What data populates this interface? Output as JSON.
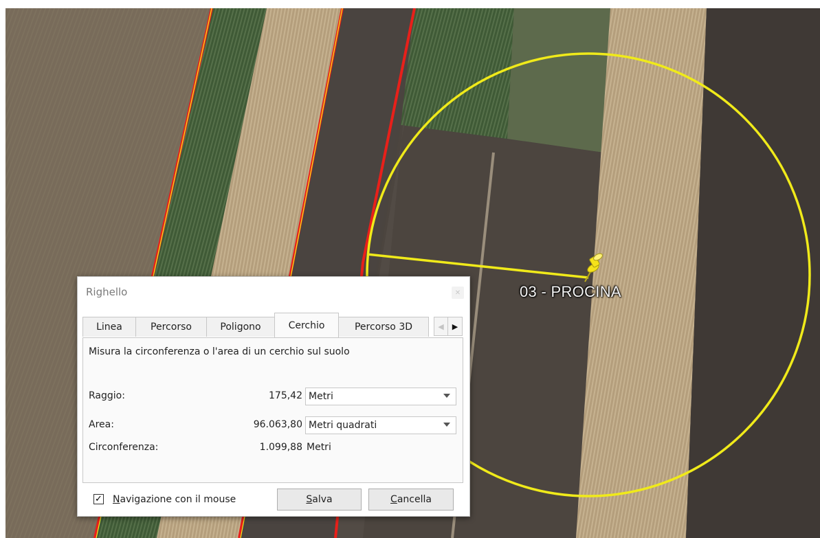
{
  "map": {
    "placemark_label": "03 - PROCINA",
    "colors": {
      "circle": "#f0ea1a",
      "boundary": "#e8201a",
      "pin": "#f5e21a"
    }
  },
  "dialog": {
    "title": "Righello",
    "close_icon": "close-icon",
    "tabs": [
      {
        "label": "Linea"
      },
      {
        "label": "Percorso"
      },
      {
        "label": "Poligono"
      },
      {
        "label": "Cerchio"
      },
      {
        "label": "Percorso 3D"
      }
    ],
    "active_tab": "Cerchio",
    "description": "Misura la circonferenza o l'area di un cerchio sul suolo",
    "rows": {
      "radius": {
        "label": "Raggio:",
        "value": "175,42",
        "unit": "Metri"
      },
      "area": {
        "label": "Area:",
        "value": "96.063,80",
        "unit": "Metri quadrati"
      },
      "circumference": {
        "label": "Circonferenza:",
        "value": "1.099,88",
        "unit": "Metri"
      }
    },
    "mouse_nav": {
      "checked": true,
      "label_prefix": "N",
      "label_rest": "avigazione con il mouse"
    },
    "buttons": {
      "save": {
        "prefix": "S",
        "rest": "alva"
      },
      "cancel": {
        "prefix": "C",
        "rest": "ancella"
      }
    }
  }
}
